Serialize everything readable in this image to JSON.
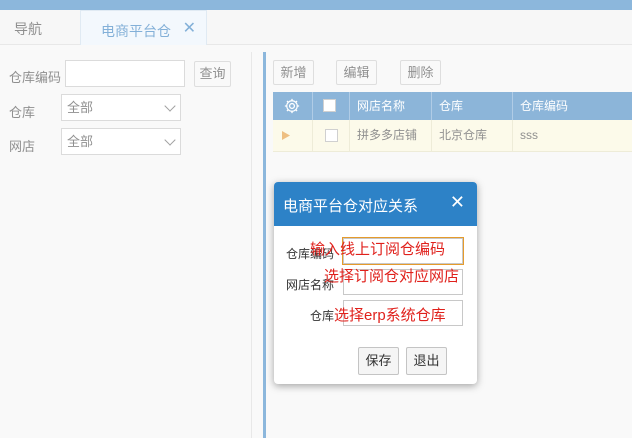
{
  "tabs": {
    "nav_label": "导航",
    "active_label": "电商平台仓",
    "close_glyph": "✕"
  },
  "filters": {
    "warehouse_code_label": "仓库编码",
    "warehouse_code_value": "",
    "query_button": "查询",
    "warehouse_label": "仓库",
    "warehouse_selected": "全部",
    "shop_label": "网店",
    "shop_selected": "全部"
  },
  "toolbar": {
    "add": "新增",
    "edit": "编辑",
    "delete": "删除"
  },
  "grid": {
    "columns": [
      "网店名称",
      "仓库",
      "仓库编码"
    ],
    "rows": [
      {
        "shop": "拼多多店铺",
        "warehouse": "北京仓库",
        "code": "sss"
      }
    ]
  },
  "dialog": {
    "title": "电商平台仓对应关系",
    "close_glyph": "✕",
    "fields": {
      "code_label": "仓库编码",
      "shop_label": "网店名称",
      "warehouse_label": "仓库"
    },
    "save": "保存",
    "exit": "退出",
    "annotations": {
      "code": "输入线上订阅仓编码",
      "shop": "选择订阅仓对应网店",
      "warehouse": "选择erp系统仓库"
    }
  },
  "colors": {
    "primary": "#2f7cc0",
    "dialog_header": "#2d82c7",
    "selected_row": "#faf6d9",
    "annotation": "#e0211c",
    "row_marker": "#e08a1c"
  }
}
